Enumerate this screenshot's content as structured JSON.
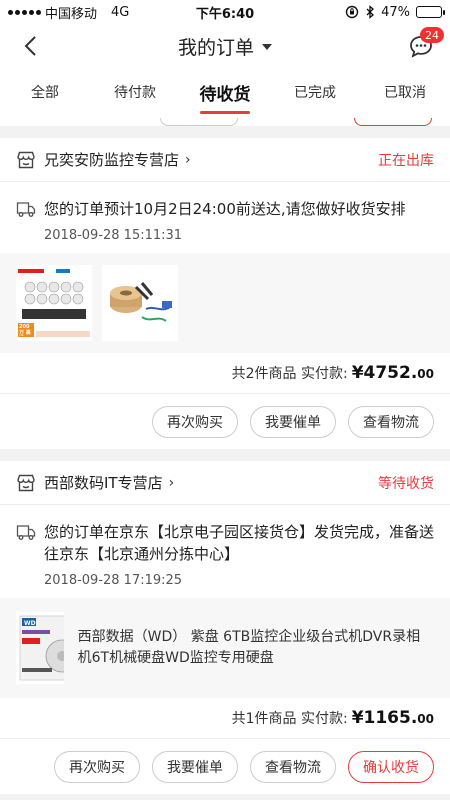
{
  "status_bar": {
    "carrier": "中国移动",
    "network": "4G",
    "time": "下午6:40",
    "battery": "47%",
    "battery_level": 0.47
  },
  "header": {
    "title": "我的订单",
    "badge": "24"
  },
  "tabs": [
    {
      "label": "全部"
    },
    {
      "label": "待付款"
    },
    {
      "label": "待收货",
      "active": true
    },
    {
      "label": "已完成"
    },
    {
      "label": "已取消"
    }
  ],
  "orders": [
    {
      "shop": "兄奕安防监控专营店",
      "status": "正在出库",
      "message": "您的订单预计10月2日24:00前送达,请您做好收货安排",
      "time": "2018-09-28 15:11:31",
      "thumb1_text": "200万 高清",
      "total_label": "共2件商品  实付款:",
      "price_main": "¥4752.",
      "price_cents": "00",
      "buttons": [
        "再次购买",
        "我要催单",
        "查看物流"
      ]
    },
    {
      "shop": "西部数码IT专营店",
      "status": "等待收货",
      "message": "您的订单在京东【北京电子园区接货仓】发货完成，准备送往京东【北京通州分拣中心】",
      "time": "2018-09-28 17:19:25",
      "product_name": "西部数据（WD） 紫盘 6TB监控企业级台式机DVR录相机6T机械硬盘WD监控专用硬盘",
      "total_label": "共1件商品  实付款:",
      "price_main": "¥1165.",
      "price_cents": "00",
      "buttons": [
        "再次购买",
        "我要催单",
        "查看物流",
        "确认收货"
      ]
    }
  ],
  "colors": {
    "accent": "#e93b3d",
    "badge": "#f23030"
  }
}
